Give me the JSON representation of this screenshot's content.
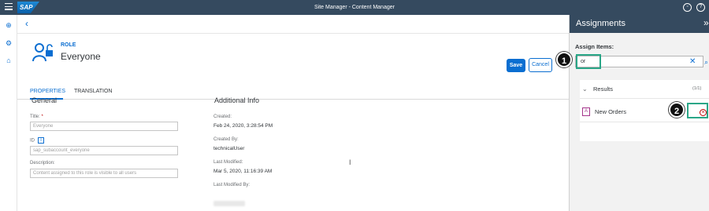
{
  "shell": {
    "logo": "SAP",
    "title": "Site Manager - Content Manager",
    "help_icon": "help-icon",
    "user_icon": "user-icon"
  },
  "nav": {
    "icons": [
      "globe-icon",
      "settings-icon",
      "hierarchy-icon"
    ]
  },
  "header": {
    "type": "ROLE",
    "name": "Everyone",
    "save": "Save",
    "cancel": "Cancel"
  },
  "tabs": [
    "PROPERTIES",
    "TRANSLATION"
  ],
  "general": {
    "title": "General",
    "title_label": "Title:",
    "title_required": "*",
    "title_placeholder": "Everyone",
    "id_label": "ID",
    "id_placeholder": "sap_subaccount_everyone",
    "desc_label": "Description:",
    "desc_placeholder": "Content assigned to this role is visible to all users"
  },
  "info": {
    "title": "Additional Info",
    "created_label": "Created:",
    "created_value": "Feb 24, 2020, 3:28:54 PM",
    "created_by_label": "Created By:",
    "created_by_value": "technicalUser",
    "modified_label": "Last Modified:",
    "modified_value": "Mar 5, 2020, 11:16:39 AM",
    "modified_by_label": "Last Modified By:"
  },
  "panel": {
    "title": "Assignments",
    "close": "»",
    "assign_label": "Assign Items:",
    "search_value": "or",
    "results_title": "Results",
    "results_count": "(1/1)",
    "result_item": "New Orders",
    "highlight_color": "#2aa687"
  },
  "annotations": {
    "badge1": "1",
    "badge2": "2"
  }
}
